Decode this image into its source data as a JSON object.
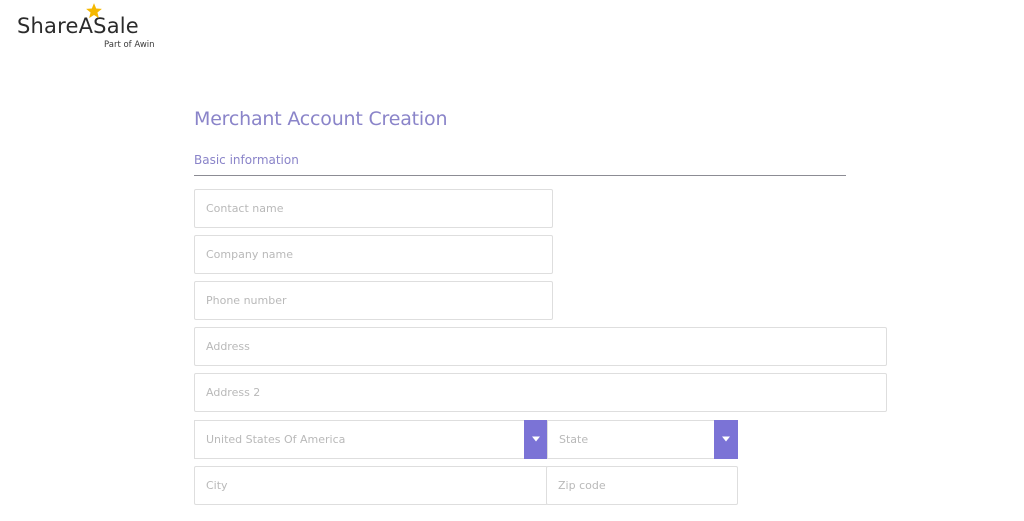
{
  "logo": {
    "name": "ShareASale",
    "tagline": "Part of Awin",
    "star_color": "#f5b800"
  },
  "page": {
    "title": "Merchant Account Creation",
    "section": "Basic information"
  },
  "form": {
    "contact_name": {
      "placeholder": "Contact name",
      "value": ""
    },
    "company_name": {
      "placeholder": "Company name",
      "value": ""
    },
    "phone_number": {
      "placeholder": "Phone number",
      "value": ""
    },
    "address": {
      "placeholder": "Address",
      "value": ""
    },
    "address2": {
      "placeholder": "Address 2",
      "value": ""
    },
    "country": {
      "selected": "United States Of America"
    },
    "state": {
      "selected": "State"
    },
    "city": {
      "placeholder": "City",
      "value": ""
    },
    "zip_code": {
      "placeholder": "Zip code",
      "value": ""
    }
  },
  "colors": {
    "accent": "#7b73d6",
    "heading": "#8a84c9",
    "border": "#dedede",
    "placeholder": "#b9b9b9"
  },
  "icons": {
    "select_arrow": "caret-down-icon",
    "logo_mark": "star-icon"
  }
}
